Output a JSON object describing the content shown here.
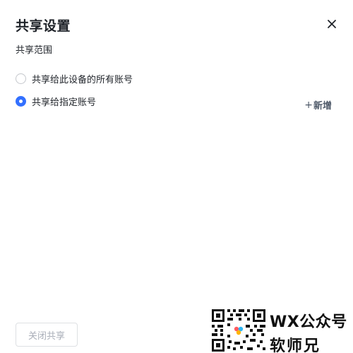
{
  "dialog": {
    "title": "共享设置",
    "close_icon": "close-icon",
    "subtitle": "共享范围",
    "options": [
      {
        "label": "共享给此设备的所有账号",
        "checked": false
      },
      {
        "label": "共享给指定账号",
        "checked": true
      }
    ],
    "add_label": "新增",
    "add_icon": "plus-icon",
    "stop_share_label": "关闭共享"
  },
  "watermark": {
    "line1": "WX公众号",
    "line2": "软师兄"
  },
  "colors": {
    "accent": "#3370ff",
    "text": "#1f2329",
    "disabled_text": "#a9aeb8",
    "border": "#dee0e3"
  }
}
